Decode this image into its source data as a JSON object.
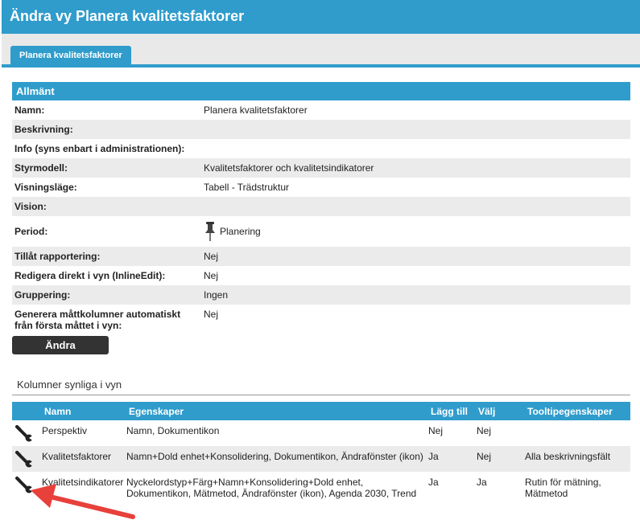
{
  "header": {
    "title": "Ändra vy Planera kvalitetsfaktorer"
  },
  "tabs": [
    {
      "label": "Planera kvalitetsfaktorer"
    }
  ],
  "general": {
    "heading": "Allmänt",
    "rows": [
      {
        "label": "Namn:",
        "value": "Planera kvalitetsfaktorer"
      },
      {
        "label": "Beskrivning:",
        "value": ""
      },
      {
        "label": "Info (syns enbart i administrationen):",
        "value": ""
      },
      {
        "label": "Styrmodell:",
        "value": "Kvalitetsfaktorer och kvalitetsindikatorer"
      },
      {
        "label": "Visningsläge:",
        "value": "Tabell - Trädstruktur"
      },
      {
        "label": "Vision:",
        "value": ""
      },
      {
        "label": "Period:",
        "value": "Planering",
        "icon": "pushpin-icon"
      },
      {
        "label": "Tillåt rapportering:",
        "value": "Nej"
      },
      {
        "label": "Redigera direkt i vyn (InlineEdit):",
        "value": "Nej"
      },
      {
        "label": "Gruppering:",
        "value": "Ingen"
      },
      {
        "label_line1": "Generera måttkolumner automatiskt",
        "label_line2": "från första måttet i vyn:",
        "value": "Nej"
      }
    ],
    "edit_button": "Ändra"
  },
  "columns": {
    "title": "Kolumner synliga i vyn",
    "headers": {
      "namn": "Namn",
      "egenskaper": "Egenskaper",
      "lagg_till": "Lägg till",
      "valj": "Välj",
      "tooltip": "Tooltipegenskaper"
    },
    "rows": [
      {
        "namn": "Perspektiv",
        "egenskaper_1": "Namn, Dokumentikon",
        "egenskaper_2": "",
        "lagg_till": "Nej",
        "valj": "Nej",
        "tooltip_1": "",
        "tooltip_2": ""
      },
      {
        "namn": "Kvalitetsfaktorer",
        "egenskaper_1": "Namn+Dold enhet+Konsolidering, Dokumentikon, Ändrafönster (ikon)",
        "egenskaper_2": "",
        "lagg_till": "Ja",
        "valj": "Nej",
        "tooltip_1": "Alla beskrivningsfält",
        "tooltip_2": ""
      },
      {
        "namn": "Kvalitetsindikatorer",
        "egenskaper_1": "Nyckelordstyp+Färg+Namn+Konsolidering+Dold enhet,",
        "egenskaper_2": "Dokumentikon, Mätmetod, Ändrafönster (ikon), Agenda 2030, Trend",
        "lagg_till": "Ja",
        "valj": "Ja",
        "tooltip_1": "Rutin för mätning,",
        "tooltip_2": "Mätmetod"
      }
    ]
  },
  "colors": {
    "accent": "#2f9ccc",
    "row_alt": "#ebebeb",
    "button_dark": "#333333",
    "annotation_arrow": "#e8403a"
  }
}
